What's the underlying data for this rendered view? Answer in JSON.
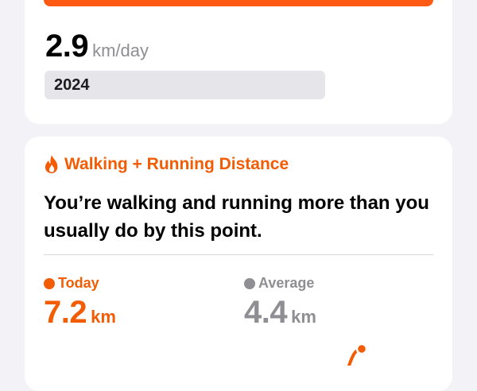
{
  "summary_card": {
    "average_value": "2.9",
    "average_unit": "km/day",
    "year_label": "2024"
  },
  "trend_card": {
    "title": "Walking + Running Distance",
    "icon": "flame-icon",
    "headline": "You’re walking and running more than you usually do by this point.",
    "today": {
      "label": "Today",
      "value": "7.2",
      "unit": "km"
    },
    "average": {
      "label": "Average",
      "value": "4.4",
      "unit": "km"
    }
  },
  "colors": {
    "accent": "#F25C05",
    "bar": "#FF5A14",
    "secondary": "#8E8E93",
    "background": "#F2F2F7",
    "card": "#FFFFFF"
  }
}
